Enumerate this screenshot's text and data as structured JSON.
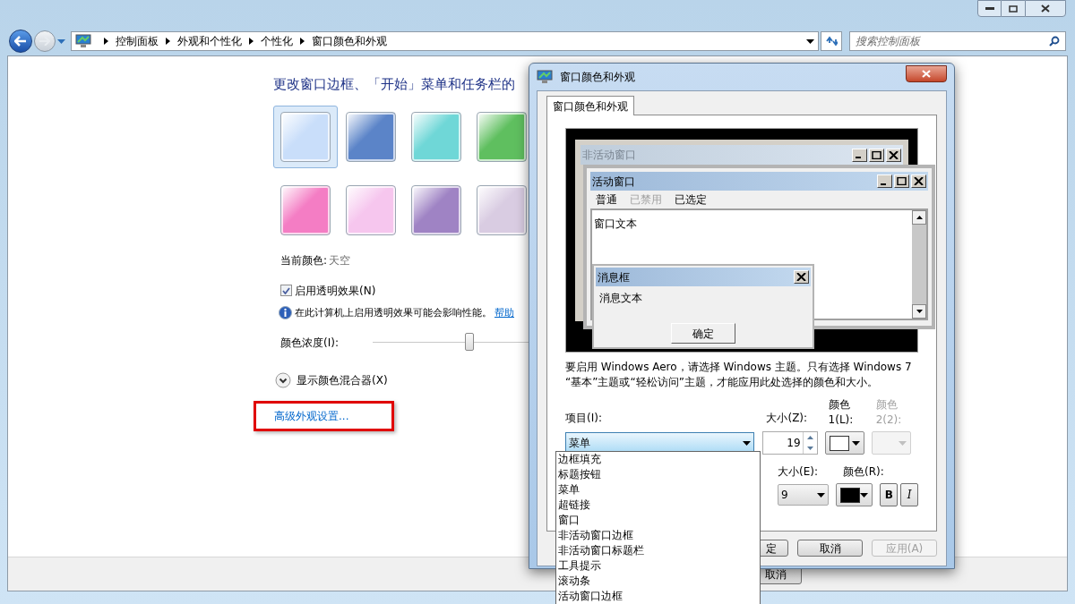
{
  "explorer": {
    "breadcrumb": [
      "控制面板",
      "外观和个性化",
      "个性化",
      "窗口颜色和外观"
    ],
    "search": {
      "placeholder": "搜索控制面板"
    },
    "heading": "更改窗口边框、「开始」菜单和任务栏的",
    "swatches": [
      {
        "color": "#c9defa",
        "selected": true
      },
      {
        "color": "#5b84c8",
        "selected": false
      },
      {
        "color": "#6fd7d7",
        "selected": false
      },
      {
        "color": "#5fbf5f",
        "selected": false
      },
      {
        "color": "#f47dc4",
        "selected": false
      },
      {
        "color": "#f6c6ee",
        "selected": false
      },
      {
        "color": "#9f83c4",
        "selected": false
      },
      {
        "color": "#d9cce2",
        "selected": false
      }
    ],
    "current_color": {
      "label": "当前颜色:",
      "value": "天空"
    },
    "transparency": {
      "label": "启用透明效果(N)",
      "checked": true
    },
    "info": {
      "text": "在此计算机上启用透明效果可能会影响性能。",
      "link": "帮助"
    },
    "intensity": {
      "label": "颜色浓度(I):",
      "level": 0.5
    },
    "mixer": {
      "label": "显示颜色混合器(X)",
      "expanded": false
    },
    "advanced_link": {
      "text": "高级外观设置...",
      "highlighted": true
    },
    "footer_button": "取消"
  },
  "dialog": {
    "title": "窗口颜色和外观",
    "tabs": [
      {
        "label": "窗口颜色和外观",
        "selected": true
      }
    ],
    "preview": {
      "inactive_title": "非活动窗口",
      "active_title": "活动窗口",
      "menu": [
        {
          "label": "普通",
          "disabled": false
        },
        {
          "label": "已禁用",
          "disabled": true
        },
        {
          "label": "已选定",
          "disabled": false
        }
      ],
      "window_text": "窗口文本",
      "message_title": "消息框",
      "message_text": "消息文本",
      "message_button": "确定"
    },
    "note": "要启用 Windows Aero，请选择 Windows 主题。只有选择 Windows 7 “基本”主题或“轻松访问”主题，才能应用此处选择的颜色和大小。",
    "item": {
      "label": "项目(I):",
      "value": "菜单",
      "expanded": true,
      "options": [
        "边框填充",
        "标题按钮",
        "菜单",
        "超链接",
        "窗口",
        "非活动窗口边框",
        "非活动窗口标题栏",
        "工具提示",
        "滚动条",
        "活动窗口边框"
      ]
    },
    "size": {
      "label": "大小(Z):",
      "value": "19"
    },
    "color1": {
      "label": "颜色 1(L):",
      "color": "#ffffff"
    },
    "color2": {
      "label": "颜色 2(2):",
      "disabled": true
    },
    "font_size": {
      "label": "大小(E):",
      "value": "9"
    },
    "font_color": {
      "label": "颜色(R):",
      "color": "#000000"
    },
    "bold": {
      "label": "B",
      "on": false
    },
    "italic": {
      "label": "I",
      "on": false
    },
    "buttons": [
      {
        "label": "定",
        "disabled": false
      },
      {
        "label": "取消",
        "disabled": false
      },
      {
        "label": "应用(A)",
        "disabled": true
      }
    ]
  }
}
